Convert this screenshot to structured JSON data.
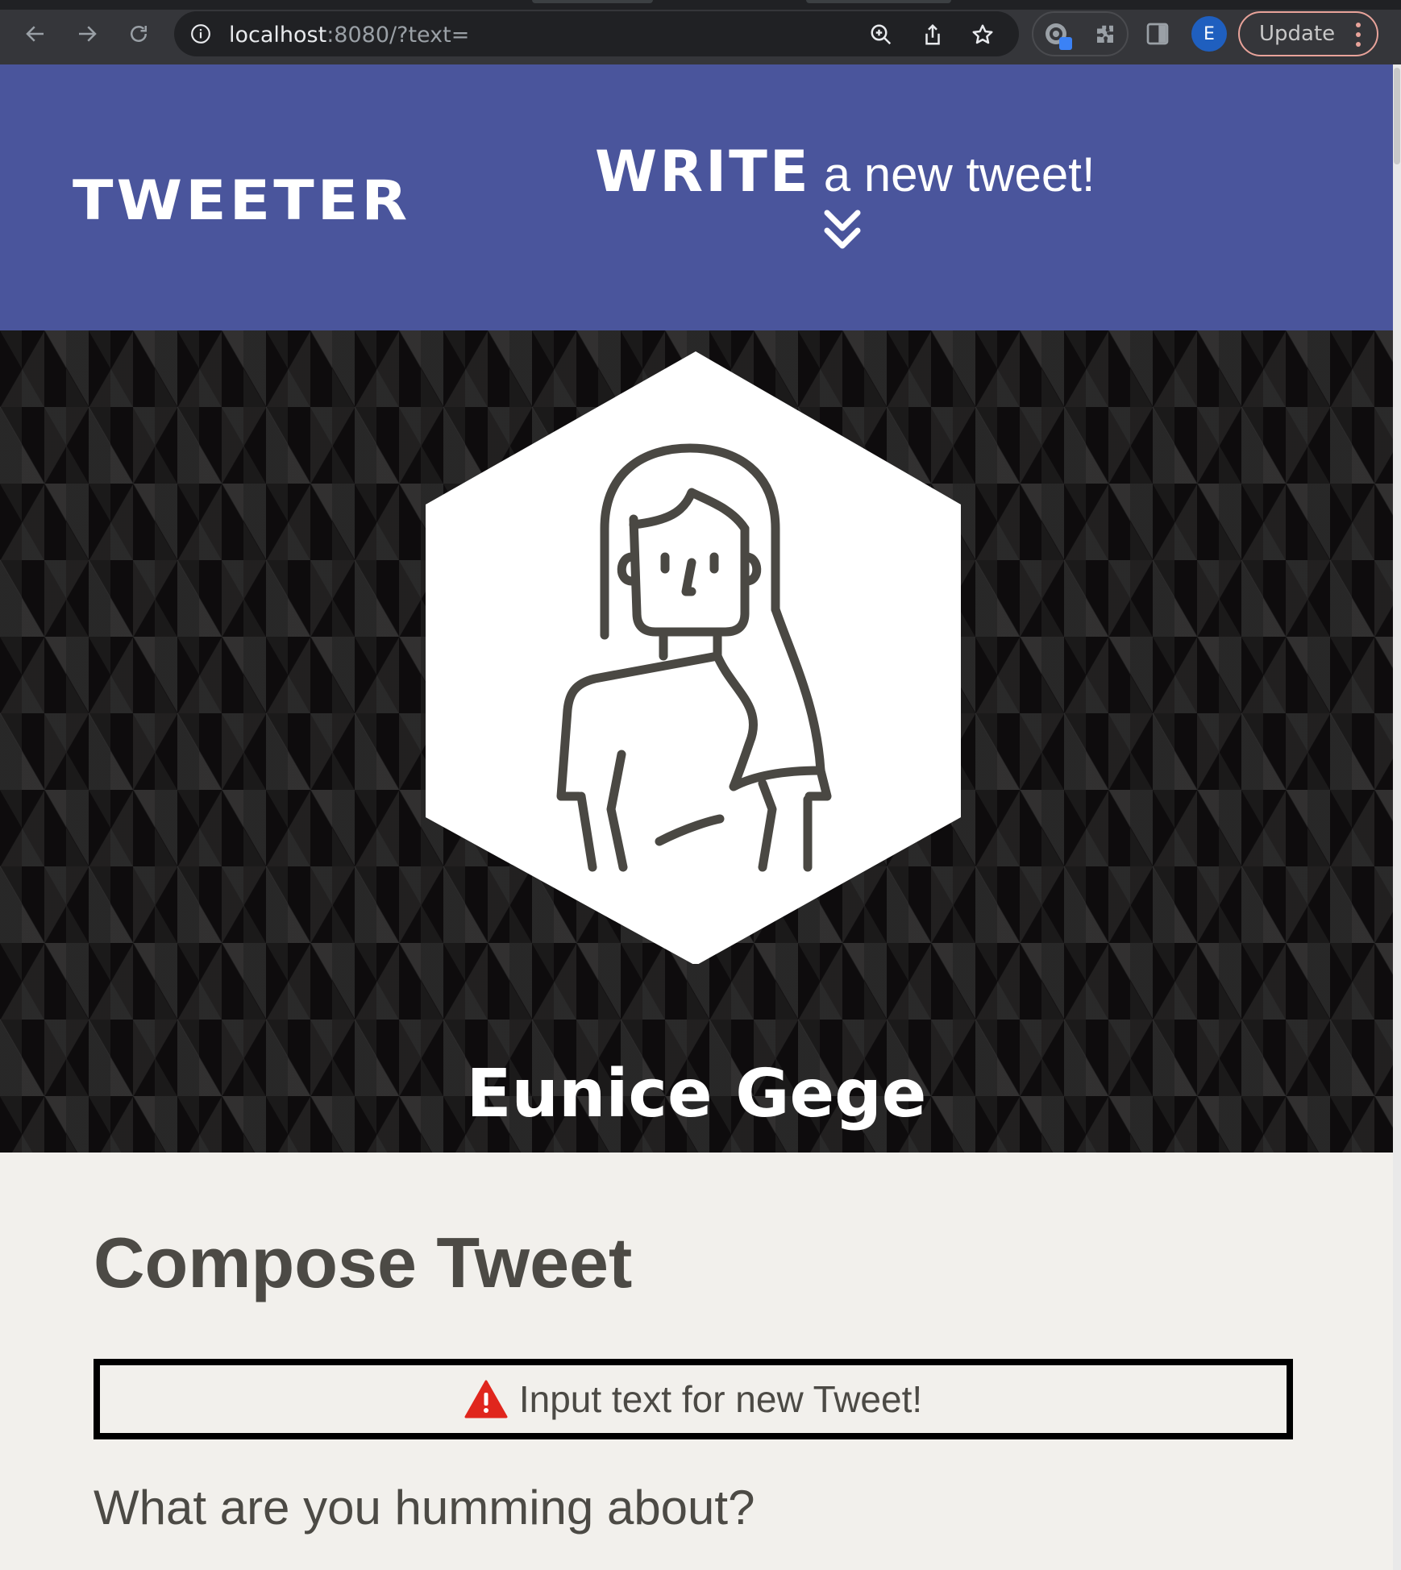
{
  "browser": {
    "url_host": "localhost",
    "url_rest": ":8080/?text=",
    "profile_initial": "E",
    "update_label": "Update"
  },
  "header": {
    "logo": "TWEETER",
    "write_bold": "WRITE",
    "write_rest": "a new tweet!"
  },
  "profile": {
    "name": "Eunice Gege"
  },
  "compose": {
    "title": "Compose Tweet",
    "error_message": "Input text for new Tweet!",
    "prompt_label": "What are you humming about?"
  },
  "colors": {
    "header_bg": "#4a559c",
    "page_bg": "#f2f0ec",
    "text_dark": "#4c4a45",
    "error_icon": "#e0261d"
  }
}
